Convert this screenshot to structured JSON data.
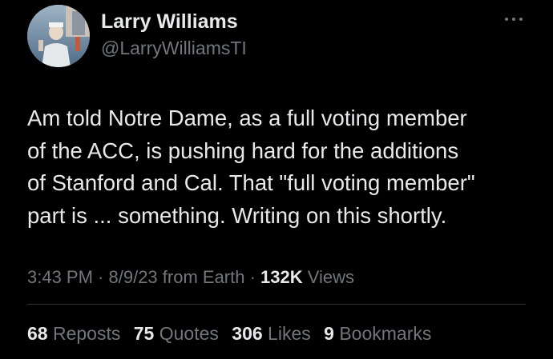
{
  "author": {
    "display_name": "Larry Williams",
    "handle": "@LarryWilliamsTI",
    "avatar_icon": "profile-photo"
  },
  "more_icon": "more-horizontal-icon",
  "tweet": {
    "text": "Am told Notre Dame, as a full voting member\nof the ACC, is pushing hard for the additions\nof Stanford and Cal. That \"full voting member\"\npart is ... something. Writing on this shortly."
  },
  "meta": {
    "time": "3:43 PM",
    "sep1": " · ",
    "date": "8/9/23",
    "source": " from Earth",
    "sep2": " · ",
    "views_count": "132K",
    "views_label": " Views"
  },
  "stats": {
    "reposts_count": "68",
    "reposts_label": " Reposts",
    "quotes_count": "75",
    "quotes_label": " Quotes",
    "likes_count": "306",
    "likes_label": " Likes",
    "bookmarks_count": "9",
    "bookmarks_label": " Bookmarks"
  },
  "colors": {
    "background": "#000000",
    "primary_text": "#e7e9ea",
    "secondary_text": "#71767b",
    "divider": "#2f3336"
  }
}
